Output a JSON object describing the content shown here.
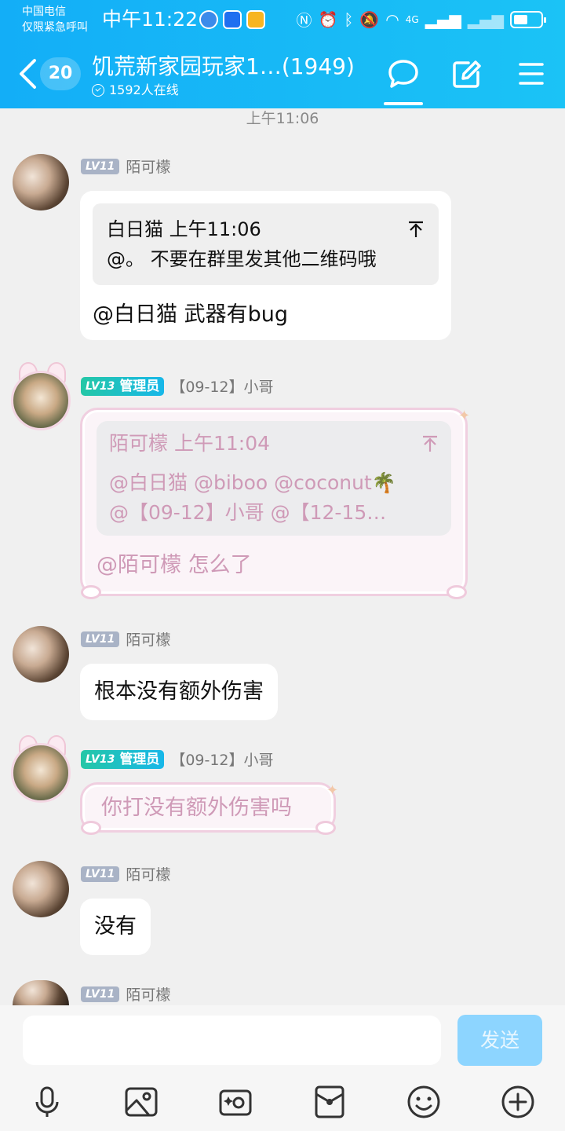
{
  "status_bar": {
    "carrier_line1": "中国电信",
    "carrier_line2": "仅限紧急呼叫",
    "time": "中午11:22",
    "network": "4G"
  },
  "header": {
    "unread_count": "20",
    "title": "饥荒新家园玩家1…(1949)",
    "online_text": "1592人在线"
  },
  "chat": {
    "time_divider": "上午11:06",
    "messages": [
      {
        "level": "LV11",
        "sender": "陌可檬",
        "quote_sender": "白日猫",
        "quote_time": "上午11:06",
        "quote_text": "@。 不要在群里发其他二维码哦",
        "text": "@白日猫 武器有bug"
      },
      {
        "level": "LV13",
        "role": "管理员",
        "sender": "【09-12】小哥",
        "quote_sender": "陌可檬",
        "quote_time": "上午11:04",
        "quote_line1": "@白日猫 @biboo @coconut🌴",
        "quote_line2": "@【09-12】小哥 @【12-15…",
        "text": "@陌可檬 怎么了"
      },
      {
        "level": "LV11",
        "sender": "陌可檬",
        "text": "根本没有额外伤害"
      },
      {
        "level": "LV13",
        "role": "管理员",
        "sender": "【09-12】小哥",
        "text": "你打没有额外伤害吗"
      },
      {
        "level": "LV11",
        "sender": "陌可檬",
        "text": "没有"
      },
      {
        "level": "LV11",
        "sender": "陌可檬"
      }
    ]
  },
  "input_bar": {
    "placeholder": "",
    "send_label": "发送"
  },
  "colors": {
    "header_gradient_start": "#13aef7",
    "header_gradient_end": "#1bc3f6",
    "chat_background": "#f0f0f0",
    "send_button": "#8dd5ff",
    "admin_badge": "#24c7a6",
    "pink_text": "#cf9ab7"
  },
  "icons": {
    "header": [
      "back-icon",
      "chat-bubble-icon",
      "edit-icon",
      "menu-icon"
    ],
    "toolbar": [
      "microphone-icon",
      "image-icon",
      "camera-icon",
      "red-packet-icon",
      "emoji-icon",
      "plus-icon"
    ]
  }
}
